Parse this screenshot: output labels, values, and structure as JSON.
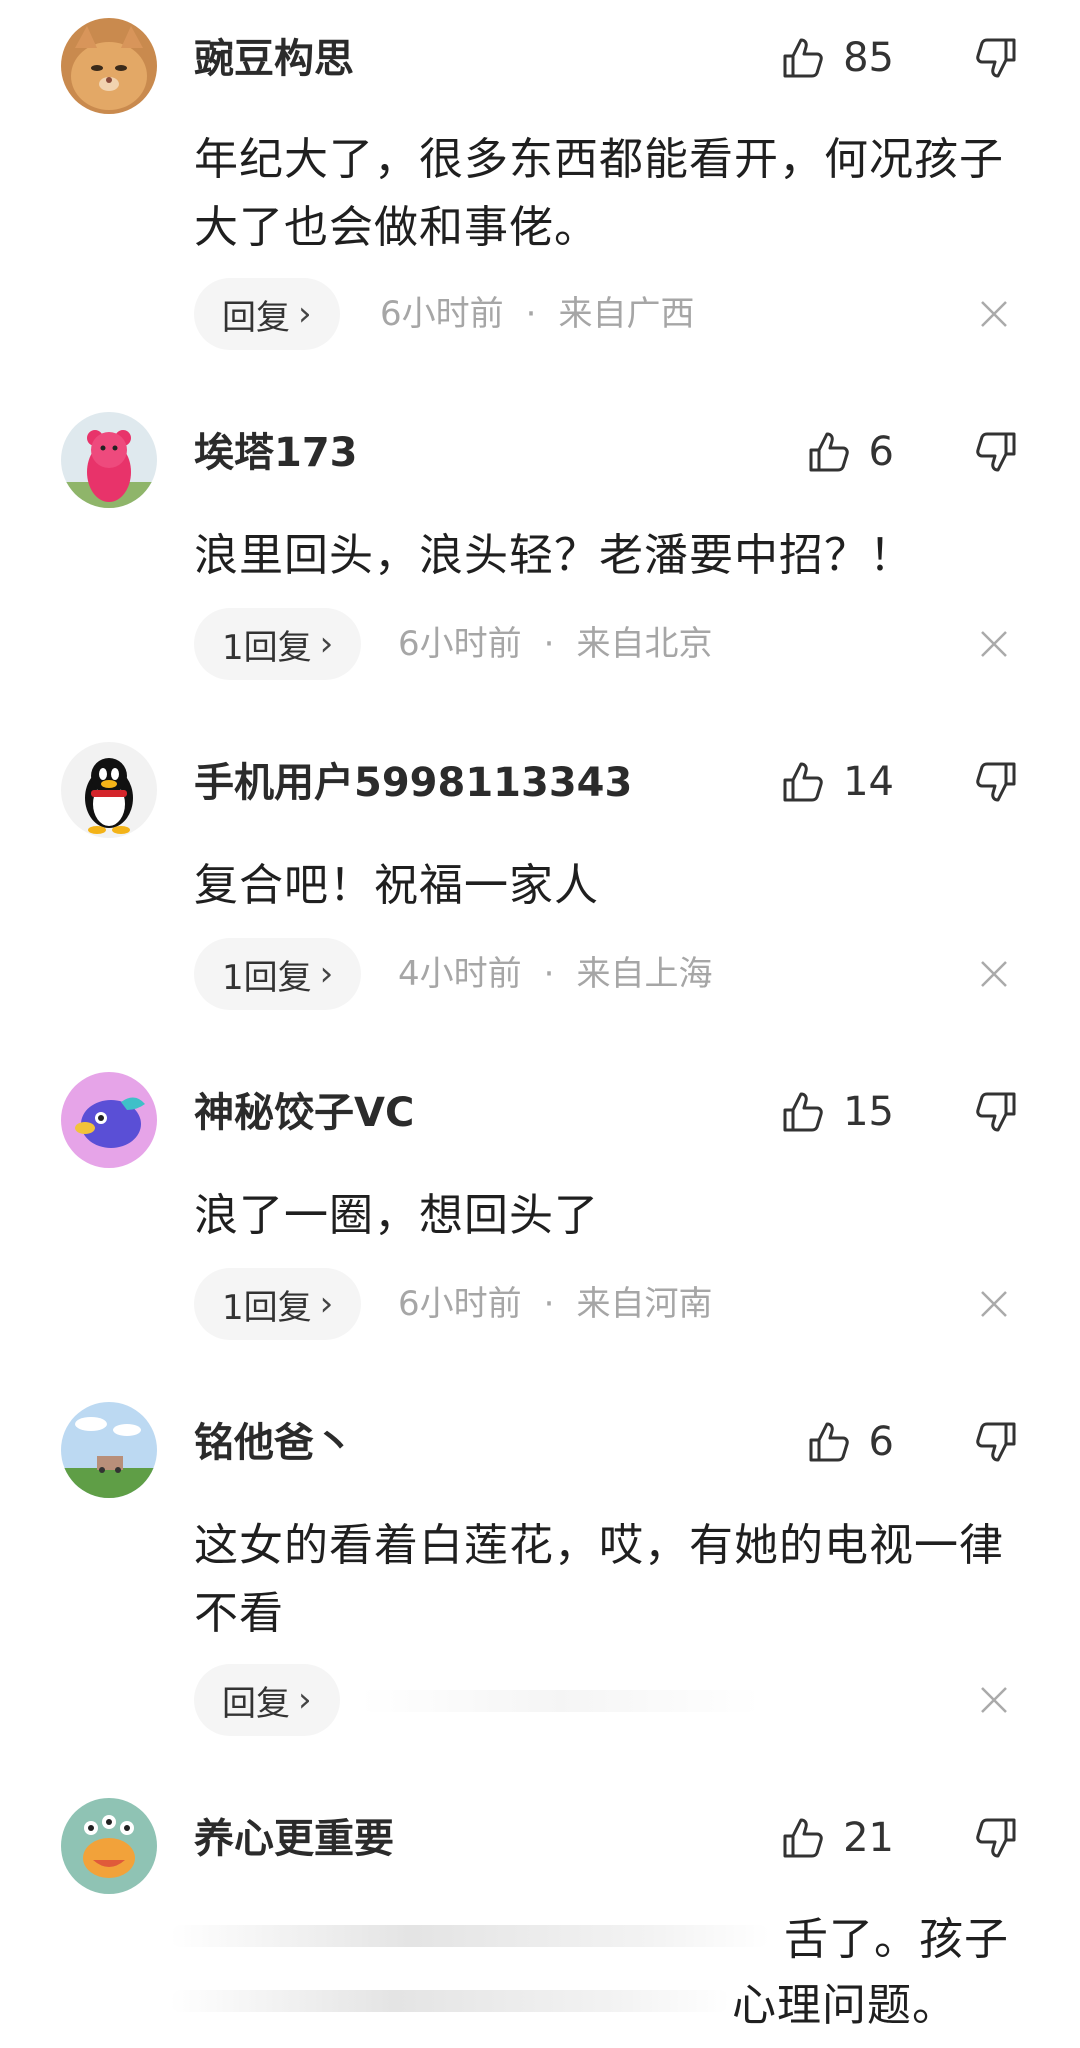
{
  "colors": {
    "meta": "#a6a6a6",
    "reply_bg": "#f5f5f5",
    "text": "#1f1f1f"
  },
  "comments": [
    {
      "username": "豌豆构思",
      "likes": "85",
      "text": "年纪大了，很多东西都能看开，何况孩子大了也会做和事佬。",
      "reply_label": "回复",
      "time": "6小时前",
      "location": "来自广西",
      "avatar": "cat-avatar"
    },
    {
      "username": "埃塔173",
      "likes": "6",
      "text": "浪里回头，浪头轻？老潘要中招？！",
      "reply_label": "1回复",
      "time": "6小时前",
      "location": "来自北京",
      "avatar": "pink-bear-avatar"
    },
    {
      "username": "手机用户5998113343",
      "likes": "14",
      "text": "复合吧！祝福一家人",
      "reply_label": "1回复",
      "time": "4小时前",
      "location": "来自上海",
      "avatar": "penguin-avatar"
    },
    {
      "username": "神秘饺子VC",
      "likes": "15",
      "text": "浪了一圈，想回头了",
      "reply_label": "1回复",
      "time": "6小时前",
      "location": "来自河南",
      "avatar": "fish-avatar"
    },
    {
      "username": "铭他爸丶",
      "likes": "6",
      "text": "这女的看着白莲花，哎，有她的电视一律不看",
      "reply_label": "回复",
      "time": "",
      "location": "",
      "avatar": "landscape-avatar"
    },
    {
      "username": "养心更重要",
      "likes": "21",
      "text_line1": "舌了。孩子",
      "text_line2": "心理问题。",
      "avatar": "monster-avatar"
    }
  ],
  "meta_separator": "·",
  "chevron": "›"
}
